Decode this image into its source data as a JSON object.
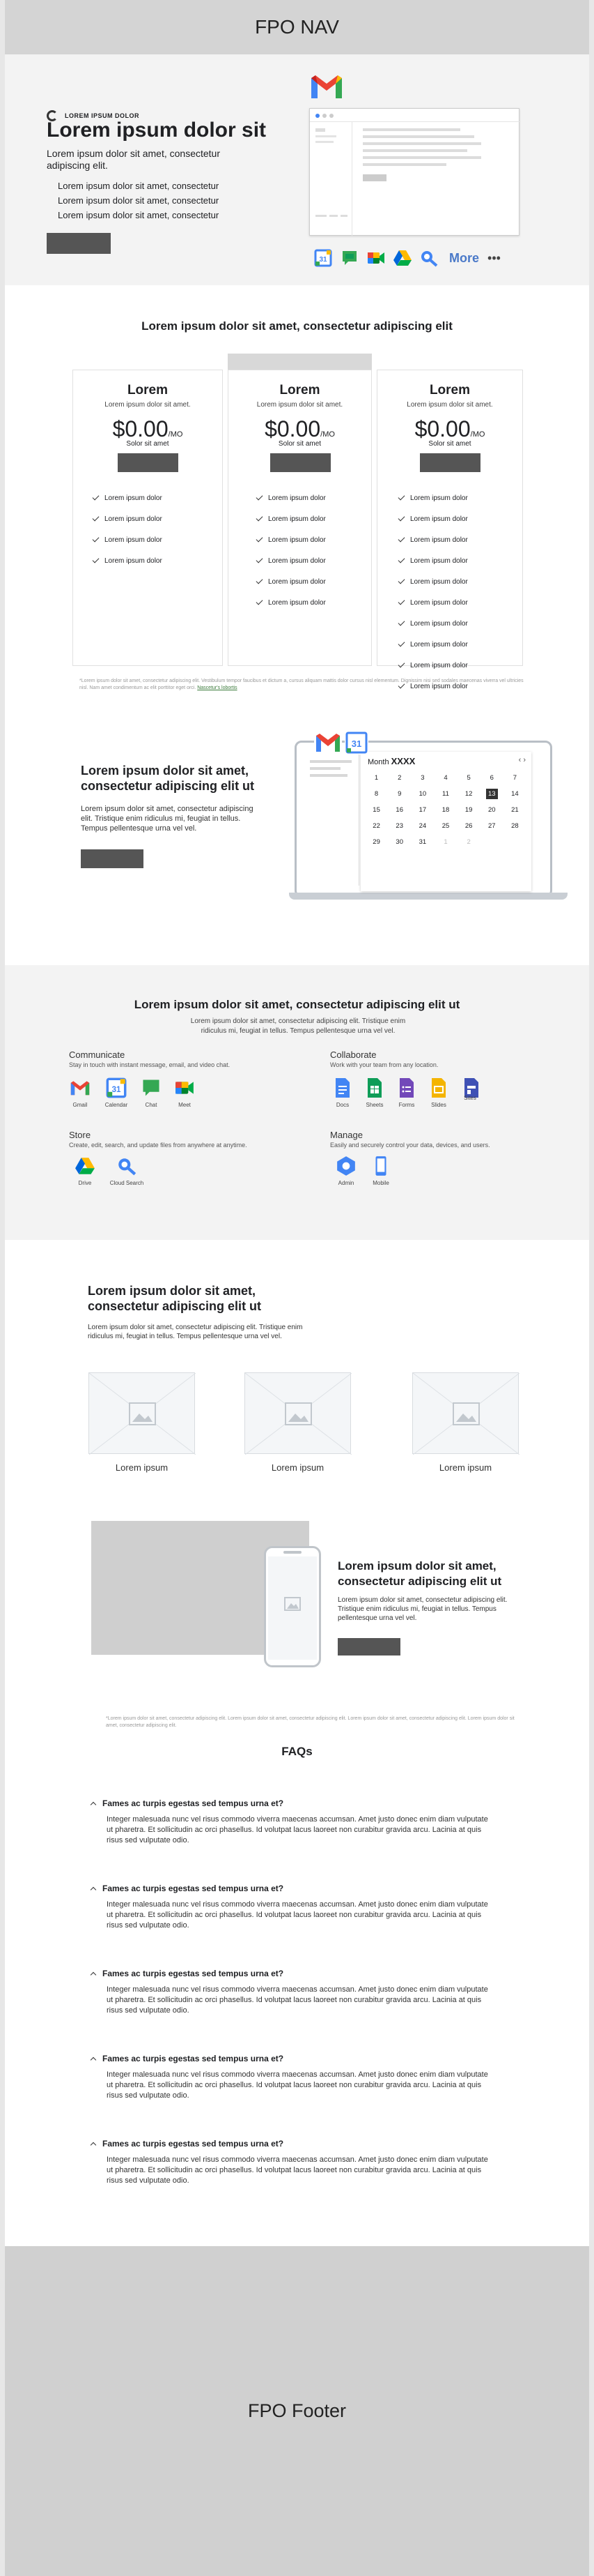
{
  "nav": {
    "label": "FPO NAV"
  },
  "hero": {
    "eyebrow": "LOREM IPSUM DOLOR",
    "title": "Lorem ipsum dolor sit",
    "subtitle": "Lorem ipsum dolor sit amet, consectetur adipiscing elit.",
    "bullets": [
      "Lorem ipsum dolor sit amet, consectetur",
      "Lorem ipsum dolor sit amet, consectetur",
      "Lorem ipsum dolor sit amet, consectetur"
    ],
    "more_label": "More",
    "more_dots": "•••",
    "apps": [
      "calendar-icon",
      "chat-icon",
      "meet-icon",
      "drive-icon",
      "cloud-search-icon"
    ]
  },
  "pricing": {
    "title": "Lorem ipsum dolor sit amet, consectetur adipiscing elit",
    "plans": [
      {
        "name": "Lorem",
        "desc": "Lorem ipsum dolor sit amet.",
        "price": "$0.00",
        "unit": "/MO",
        "price_sub": "Solor sit amet",
        "features": [
          "Lorem ipsum dolor",
          "Lorem ipsum dolor",
          "Lorem ipsum dolor",
          "Lorem ipsum dolor"
        ]
      },
      {
        "name": "Lorem",
        "desc": "Lorem ipsum dolor sit amet.",
        "price": "$0.00",
        "unit": "/MO",
        "price_sub": "Solor sit amet",
        "features": [
          "Lorem ipsum dolor",
          "Lorem ipsum dolor",
          "Lorem ipsum dolor",
          "Lorem ipsum dolor",
          "Lorem ipsum dolor",
          "Lorem ipsum dolor"
        ]
      },
      {
        "name": "Lorem",
        "desc": "Lorem ipsum dolor sit amet.",
        "price": "$0.00",
        "unit": "/MO",
        "price_sub": "Solor sit amet",
        "features": [
          "Lorem ipsum dolor",
          "Lorem ipsum dolor",
          "Lorem ipsum dolor",
          "Lorem ipsum dolor",
          "Lorem ipsum dolor",
          "Lorem ipsum dolor",
          "Lorem ipsum dolor",
          "Lorem ipsum dolor",
          "Lorem ipsum dolor",
          "Lorem ipsum dolor"
        ]
      }
    ],
    "fine_print": "*Lorem ipsum dolor sit amet, consectetur adipiscing elit. Vestibulum tempor faucibus et dictum a, cursus aliquam mattis dolor cursus nisl elementum. Dignissim nisi sed sodales maecenas viverra vel ultricies nisl. Nam amet condimentum ac elit porttitor eget orci. ",
    "fine_link": "Nascetur's lobortis"
  },
  "calendar_section": {
    "title": "Lorem ipsum dolor sit amet, consectetur adipiscing elit ut",
    "body": "Lorem ipsum dolor sit amet, consectetur adipiscing elit. Tristique enim ridiculus mi, feugiat in tellus. Tempus pellentesque urna vel vel.",
    "month": "Month",
    "year": "XXXX",
    "days": [
      "1",
      "2",
      "3",
      "4",
      "5",
      "6",
      "7",
      "8",
      "9",
      "10",
      "11",
      "12",
      "13",
      "14",
      "15",
      "16",
      "17",
      "18",
      "19",
      "20",
      "21",
      "22",
      "23",
      "24",
      "25",
      "26",
      "27",
      "28",
      "29",
      "30",
      "31",
      "1",
      "2"
    ]
  },
  "apps_section": {
    "title": "Lorem ipsum dolor sit amet, consectetur adipiscing elit ut",
    "subtitle": "Lorem ipsum dolor sit amet, consectetur adipiscing elit. Tristique enim ridiculus mi, feugiat in tellus. Tempus pellentesque urna vel vel.",
    "groups": [
      {
        "title": "Communicate",
        "desc": "Stay in touch with instant message, email, and video chat.",
        "apps": [
          "Gmail",
          "Calendar",
          "Chat",
          "Meet"
        ]
      },
      {
        "title": "Collaborate",
        "desc": "Work with your team from any location.",
        "apps": [
          "Docs",
          "Sheets",
          "Forms",
          "Slides",
          "Sites"
        ]
      },
      {
        "title": "Store",
        "desc": "Create, edit, search, and update files from anywhere at anytime.",
        "apps": [
          "Drive",
          "Cloud Search"
        ]
      },
      {
        "title": "Manage",
        "desc": "Easily and securely control your data, devices, and users.",
        "apps": [
          "Admin",
          "Mobile"
        ]
      }
    ]
  },
  "features": {
    "title": "Lorem ipsum dolor sit amet, consectetur adipiscing elit ut",
    "body": "Lorem ipsum dolor sit amet, consectetur adipiscing elit. Tristique enim ridiculus mi, feugiat in tellus. Tempus pellentesque urna vel vel.",
    "items": [
      "Lorem ipsum",
      "Lorem ipsum",
      "Lorem ipsum"
    ]
  },
  "mobile_section": {
    "title": "Lorem ipsum dolor sit amet, consectetur adipiscing elit ut",
    "body": "Lorem ipsum dolor sit amet, consectetur adipiscing elit. Tristique enim ridiculus mi, feugiat in tellus. Tempus pellentesque urna vel vel.",
    "fine_print": "*Lorem ipsum dolor sit amet, consectetur adipiscing elit. Lorem ipsum dolor sit amet, consectetur adipiscing elit. Lorem ipsum dolor sit amet, consectetur adipiscing elit. Lorem ipsum dolor sit amet, consectetur adipiscing elit."
  },
  "faqs": {
    "title": "FAQs",
    "items": [
      {
        "q": "Fames ac turpis egestas sed tempus urna et?",
        "a": "Integer malesuada nunc vel risus commodo viverra maecenas accumsan. Amet justo donec enim diam vulputate ut pharetra. Et sollicitudin ac orci phasellus. Id volutpat lacus laoreet non curabitur gravida arcu. Lacinia at quis risus sed vulputate odio."
      },
      {
        "q": "Fames ac turpis egestas sed tempus urna et?",
        "a": "Integer malesuada nunc vel risus commodo viverra maecenas accumsan. Amet justo donec enim diam vulputate ut pharetra. Et sollicitudin ac orci phasellus. Id volutpat lacus laoreet non curabitur gravida arcu. Lacinia at quis risus sed vulputate odio."
      },
      {
        "q": "Fames ac turpis egestas sed tempus urna et?",
        "a": "Integer malesuada nunc vel risus commodo viverra maecenas accumsan. Amet justo donec enim diam vulputate ut pharetra. Et sollicitudin ac orci phasellus. Id volutpat lacus laoreet non curabitur gravida arcu. Lacinia at quis risus sed vulputate odio."
      },
      {
        "q": "Fames ac turpis egestas sed tempus urna et?",
        "a": "Integer malesuada nunc vel risus commodo viverra maecenas accumsan. Amet justo donec enim diam vulputate ut pharetra. Et sollicitudin ac orci phasellus. Id volutpat lacus laoreet non curabitur gravida arcu. Lacinia at quis risus sed vulputate odio."
      },
      {
        "q": "Fames ac turpis egestas sed tempus urna et?",
        "a": "Integer malesuada nunc vel risus commodo viverra maecenas accumsan. Amet justo donec enim diam vulputate ut pharetra. Et sollicitudin ac orci phasellus. Id volutpat lacus laoreet non curabitur gravida arcu. Lacinia at quis risus sed vulputate odio."
      }
    ]
  },
  "footer": {
    "label": "FPO Footer"
  }
}
